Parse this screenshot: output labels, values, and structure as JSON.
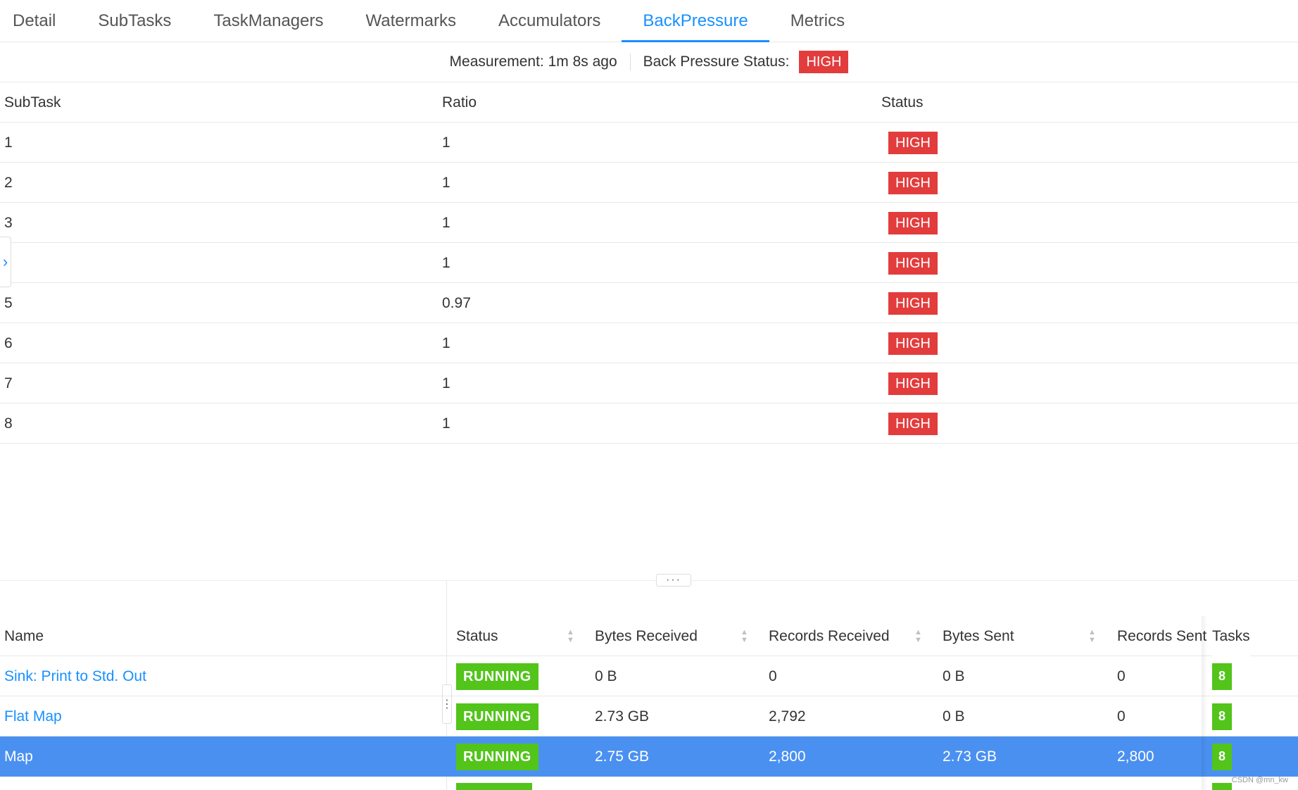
{
  "tabs": [
    {
      "label": "Detail"
    },
    {
      "label": "SubTasks"
    },
    {
      "label": "TaskManagers"
    },
    {
      "label": "Watermarks"
    },
    {
      "label": "Accumulators"
    },
    {
      "label": "BackPressure",
      "active": true
    },
    {
      "label": "Metrics"
    }
  ],
  "measurement": {
    "text": "Measurement: 1m 8s ago",
    "status_label": "Back Pressure Status:",
    "status_value": "HIGH"
  },
  "backpressure": {
    "headers": {
      "subtask": "SubTask",
      "ratio": "Ratio",
      "status": "Status"
    },
    "rows": [
      {
        "subtask": "1",
        "ratio": "1",
        "status": "HIGH"
      },
      {
        "subtask": "2",
        "ratio": "1",
        "status": "HIGH"
      },
      {
        "subtask": "3",
        "ratio": "1",
        "status": "HIGH"
      },
      {
        "subtask": "",
        "ratio": "1",
        "status": "HIGH"
      },
      {
        "subtask": "5",
        "ratio": "0.97",
        "status": "HIGH"
      },
      {
        "subtask": "6",
        "ratio": "1",
        "status": "HIGH"
      },
      {
        "subtask": "7",
        "ratio": "1",
        "status": "HIGH"
      },
      {
        "subtask": "8",
        "ratio": "1",
        "status": "HIGH"
      }
    ]
  },
  "handle": {
    "dots": "···"
  },
  "vertex_table": {
    "headers": {
      "name": "Name",
      "status": "Status",
      "bytes_received": "Bytes Received",
      "records_received": "Records Received",
      "bytes_sent": "Bytes Sent",
      "records_sent": "Records Sent",
      "tasks": "Tasks"
    },
    "rows": [
      {
        "name": "Sink: Print to Std. Out",
        "status": "RUNNING",
        "bytes_received": "0 B",
        "records_received": "0",
        "bytes_sent": "0 B",
        "records_sent": "0",
        "tasks": "8"
      },
      {
        "name": "Flat Map",
        "status": "RUNNING",
        "bytes_received": "2.73 GB",
        "records_received": "2,792",
        "bytes_sent": "0 B",
        "records_sent": "0",
        "tasks": "8"
      },
      {
        "name": "Map",
        "status": "RUNNING",
        "bytes_received": "2.75 GB",
        "records_received": "2,800",
        "bytes_sent": "2.73 GB",
        "records_sent": "2,800",
        "tasks": "8",
        "selected": true
      }
    ]
  },
  "watermark": "CSDN @mn_kw",
  "colors": {
    "accent": "#1890ff",
    "high": "#e23c3c",
    "running": "#52c41a",
    "selected_row": "#4a90f0"
  }
}
